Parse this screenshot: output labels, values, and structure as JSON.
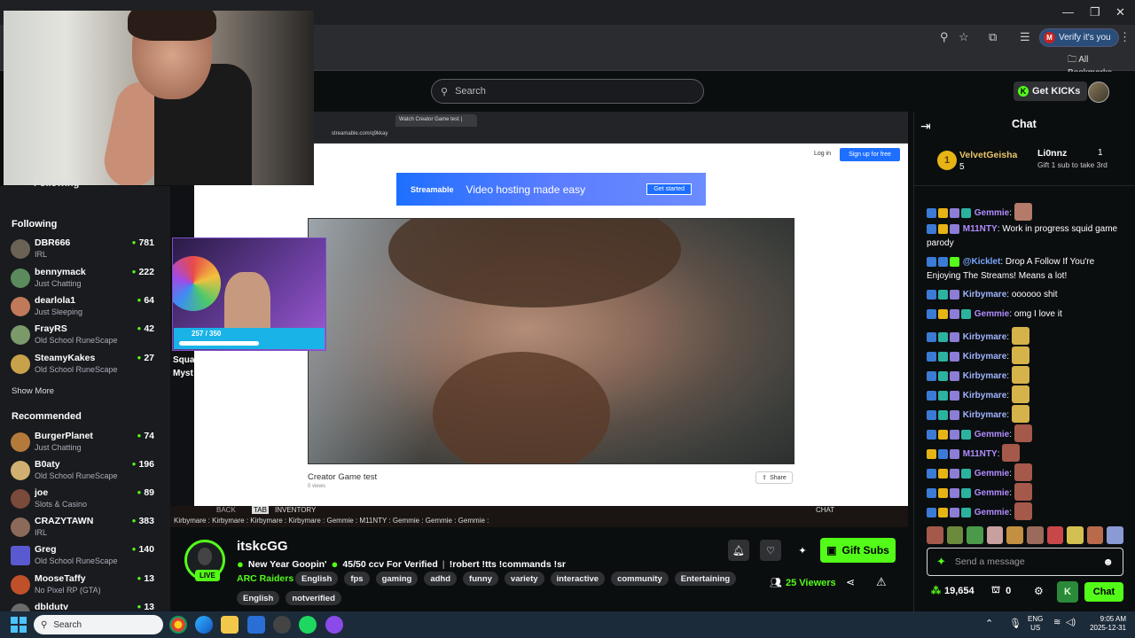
{
  "browser": {
    "verify_label": "Verify it's you",
    "verify_initial": "M",
    "bookmarks_label": "All Bookmarks"
  },
  "header": {
    "search_placeholder": "Search",
    "get_kicks_label": "Get KICKs"
  },
  "sidebar": {
    "following_header_hidden": "Following",
    "following_title": "Following",
    "following": [
      {
        "name": "DBR666",
        "category": "IRL",
        "viewers": "781"
      },
      {
        "name": "bennymack",
        "category": "Just Chatting",
        "viewers": "222"
      },
      {
        "name": "dearlola1",
        "category": "Just Sleeping",
        "viewers": "64"
      },
      {
        "name": "FrayRS",
        "category": "Old School RuneScape",
        "viewers": "42"
      },
      {
        "name": "SteamyKakes",
        "category": "Old School RuneScape",
        "viewers": "27"
      }
    ],
    "show_more": "Show More",
    "recommended_title": "Recommended",
    "recommended": [
      {
        "name": "BurgerPlanet",
        "category": "Just Chatting",
        "viewers": "74"
      },
      {
        "name": "B0aty",
        "category": "Old School RuneScape",
        "viewers": "196"
      },
      {
        "name": "joe",
        "category": "Slots & Casino",
        "viewers": "89"
      },
      {
        "name": "CRAZYTAWN",
        "category": "IRL",
        "viewers": "383"
      },
      {
        "name": "Greg",
        "category": "Old School RuneScape",
        "viewers": "140"
      },
      {
        "name": "MooseTaffy",
        "category": "No Pixel RP (GTA)",
        "viewers": "13"
      },
      {
        "name": "dbldutv",
        "category": "",
        "viewers": "13"
      }
    ]
  },
  "stream": {
    "inner_url": "streamable.com/q9kkay",
    "inner_tab": "Watch Creator Game test |",
    "inner_login": "Log in",
    "inner_signup": "Sign up for free",
    "ad_brand": "Streamable",
    "ad_text": "Video hosting made easy",
    "ad_cta": "Get started",
    "video_title": "Creator Game test",
    "video_views": "0 views",
    "share_label": "Share",
    "overlay_progress": "257 / 350",
    "overlay_text_1": "Squa",
    "overlay_text_2": "Myst",
    "strip_back": "BACK",
    "strip_tab": "TAB",
    "strip_inventory": "INVENTORY",
    "strip_chat": "CHAT",
    "strip_names": "Kirbymare :    Kirbymare :    Kirbymare :    Kirbymare :    Gemmie :    M11NTY :    Gemmie :    Gemmie :    Gemmie :"
  },
  "channel": {
    "name": "itskcGG",
    "live_label": "LIVE",
    "title_1": "New Year Goopin'",
    "title_2": "45/50 ccv For Verified",
    "title_3": "!robert !tts !commands !sr",
    "category": "ARC Raiders",
    "tags": [
      "English",
      "fps",
      "gaming",
      "adhd",
      "funny",
      "variety",
      "interactive",
      "community",
      "Entertaining"
    ],
    "tags_row2": [
      "English",
      "notverified"
    ],
    "gift_subs_label": "Gift Subs",
    "viewers": "25 Viewers"
  },
  "chat": {
    "title": "Chat",
    "pinned_user_1": "VelvetGeisha",
    "pinned_count_1": "5",
    "pinned_user_2": "Li0nnz",
    "pinned_count_2": "1",
    "pinned_sub_text": "Gift 1 sub to take 3rd",
    "messages": [
      {
        "user": "Gemmie",
        "text": "",
        "color": "#b08cff",
        "emote": "#b47a6a"
      },
      {
        "user": "M11NTY",
        "text": "Work in progress squid game parody",
        "color": "#b08cff",
        "emote": ""
      },
      {
        "user": "@Kicklet",
        "text": "Drop A Follow If You're Enjoying The Streams! Means a lot!",
        "color": "#7aa6ff",
        "emote": ""
      },
      {
        "user": "Kirbymare",
        "text": "oooooo shit",
        "color": "#9fb4ff",
        "emote": ""
      },
      {
        "user": "Gemmie",
        "text": "omg I love it",
        "color": "#b08cff",
        "emote": ""
      },
      {
        "user": "Kirbymare",
        "text": "",
        "color": "#9fb4ff",
        "emote": "#d6b24a"
      },
      {
        "user": "Kirbymare",
        "text": "",
        "color": "#9fb4ff",
        "emote": "#d6b24a"
      },
      {
        "user": "Kirbymare",
        "text": "",
        "color": "#9fb4ff",
        "emote": "#d6b24a"
      },
      {
        "user": "Kirbymare",
        "text": "",
        "color": "#9fb4ff",
        "emote": "#d6b24a"
      },
      {
        "user": "Kirbymare",
        "text": "",
        "color": "#9fb4ff",
        "emote": "#d6b24a"
      },
      {
        "user": "Gemmie",
        "text": "",
        "color": "#b08cff",
        "emote": "#a4594a"
      },
      {
        "user": "M11NTY",
        "text": "",
        "color": "#b08cff",
        "emote": "#a4594a"
      },
      {
        "user": "Gemmie",
        "text": "",
        "color": "#b08cff",
        "emote": "#a4594a"
      },
      {
        "user": "Gemmie",
        "text": "",
        "color": "#b08cff",
        "emote": "#a4594a"
      },
      {
        "user": "Gemmie",
        "text": "",
        "color": "#b08cff",
        "emote": "#a4594a"
      }
    ],
    "input_placeholder": "Send a message",
    "points": "19,654",
    "chest_count": "0",
    "send_label": "Chat"
  },
  "taskbar": {
    "search_label": "Search",
    "lang_1": "ENG",
    "lang_2": "US",
    "time": "9:05 AM",
    "date": "2025-12-31"
  },
  "colors": {
    "kick_green": "#53fc18",
    "bg": "#0b0e0f",
    "sidebar_bg": "#191b1f"
  }
}
